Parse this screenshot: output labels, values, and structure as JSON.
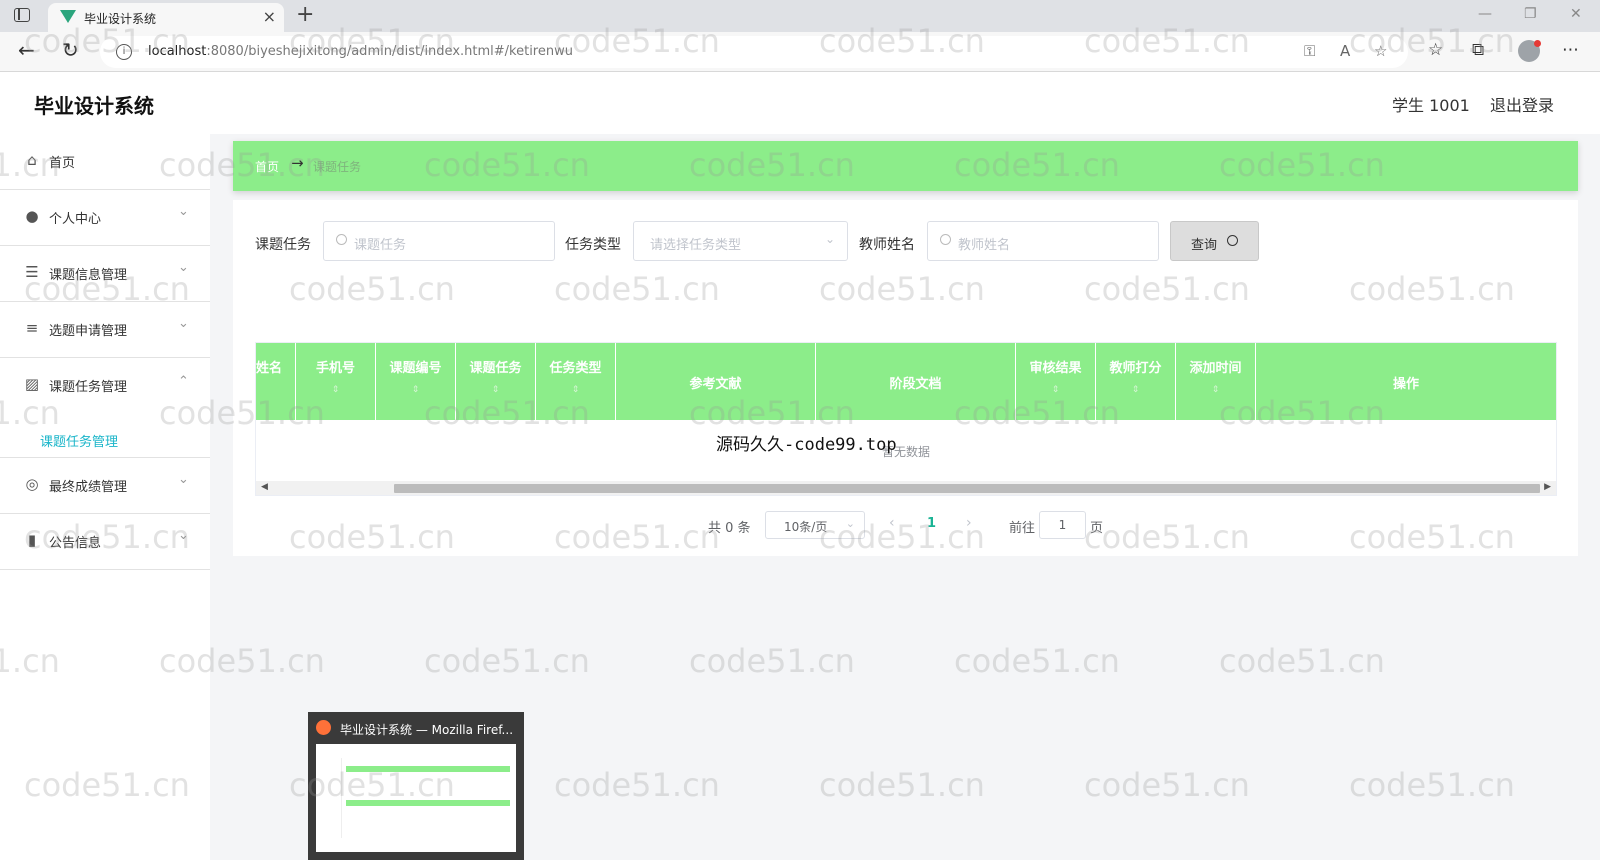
{
  "browser": {
    "tab_title": "毕业设计系统",
    "url_host": "localhost",
    "url_path": ":8080/biyeshejixitong/admin/dist/index.html#/ketirenwu"
  },
  "header": {
    "title": "毕业设计系统",
    "user": "学生 1001",
    "logout": "退出登录"
  },
  "sidebar": {
    "items": [
      {
        "label": "首页",
        "icon": "home-icon"
      },
      {
        "label": "个人中心",
        "icon": "user-icon"
      },
      {
        "label": "课题信息管理",
        "icon": "sliders-icon"
      },
      {
        "label": "选题申请管理",
        "icon": "list-icon"
      },
      {
        "label": "课题任务管理",
        "icon": "chart-icon"
      },
      {
        "label": "最终成绩管理",
        "icon": "target-icon"
      },
      {
        "label": "公告信息",
        "icon": "notebook-icon"
      }
    ],
    "active_submenu": "课题任务管理"
  },
  "breadcrumb": {
    "home": "首页",
    "current": "课题任务"
  },
  "filters": {
    "task_label": "课题任务",
    "task_placeholder": "课题任务",
    "type_label": "任务类型",
    "type_placeholder": "请选择任务类型",
    "teacher_label": "教师姓名",
    "teacher_placeholder": "教师姓名",
    "query_button": "查询"
  },
  "table": {
    "columns": [
      "姓名",
      "手机号",
      "课题编号",
      "课题任务",
      "任务类型",
      "参考文献",
      "阶段文档",
      "审核结果",
      "教师打分",
      "添加时间",
      "操作"
    ],
    "empty_text": "暂无数据"
  },
  "pagination": {
    "total": "共 0 条",
    "page_size": "10条/页",
    "current_page": "1",
    "goto_label": "前往",
    "goto_value": "1",
    "page_label": "页"
  },
  "overlay_text": "源码久久-code99.top",
  "watermark_text": "code51.cn",
  "taskbar_preview": {
    "title": "毕业设计系统 — Mozilla Firef..."
  },
  "colors": {
    "accent_green": "#8ced8a",
    "active_link": "#1ab5c9",
    "page_active": "#1ab394"
  }
}
